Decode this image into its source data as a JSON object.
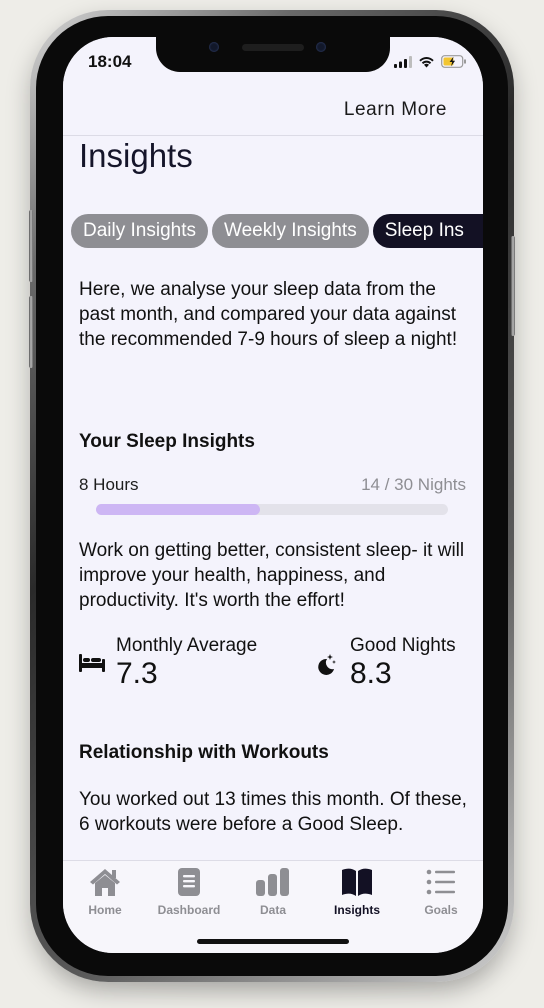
{
  "status_bar": {
    "time": "18:04"
  },
  "header": {
    "learn_more": "Learn More",
    "title": "Insights"
  },
  "tabs": [
    {
      "label": "Daily Insights",
      "active": false
    },
    {
      "label": "Weekly Insights",
      "active": false
    },
    {
      "label": "Sleep Ins",
      "active": true
    }
  ],
  "intro_text": "Here, we analyse your sleep data from the past month, and compared your data against the recommended 7-9 hours of sleep a night!",
  "sleep_insights": {
    "title": "Your Sleep Insights",
    "target_label": "8 Hours",
    "nights_label": "14 / 30 Nights",
    "progress_fraction": 0.467,
    "progress_color": "#cdb6f4",
    "advice": "Work on getting better, consistent sleep- it will improve your health, happiness, and productivity. It's worth the effort!",
    "stats": [
      {
        "label": "Monthly Average",
        "value": "7.3",
        "icon": "bed-icon"
      },
      {
        "label": "Good Nights",
        "value": "8.3",
        "icon": "moon-stars-icon"
      }
    ]
  },
  "workouts": {
    "title": "Relationship with Workouts",
    "text": "You worked out 13 times this month. Of these, 6 workouts were before a Good Sleep."
  },
  "tab_bar": [
    {
      "label": "Home",
      "icon": "house-icon",
      "active": false
    },
    {
      "label": "Dashboard",
      "icon": "document-icon",
      "active": false
    },
    {
      "label": "Data",
      "icon": "bar-chart-icon",
      "active": false
    },
    {
      "label": "Insights",
      "icon": "book-icon",
      "active": true
    },
    {
      "label": "Goals",
      "icon": "list-icon",
      "active": false
    }
  ],
  "colors": {
    "accent_dark": "#131124",
    "inactive_gray": "#8e8e93",
    "background": "#f4f3fc"
  }
}
